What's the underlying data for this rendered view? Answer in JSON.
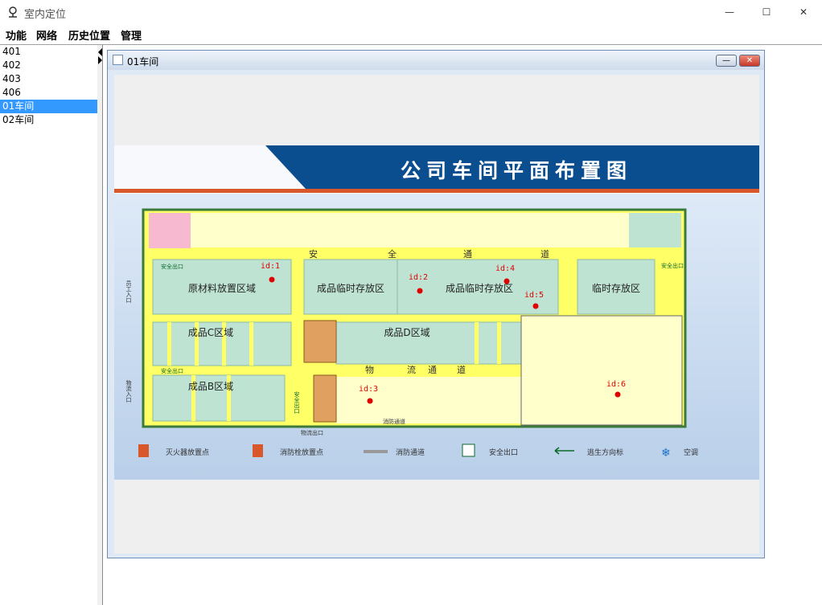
{
  "window": {
    "title": "室内定位",
    "controls": {
      "minimize": "—",
      "maximize": "☐",
      "close": "✕"
    }
  },
  "menu": {
    "items": [
      "功能",
      "网络",
      "历史位置",
      "管理"
    ]
  },
  "left_list": {
    "items": [
      "401",
      "402",
      "403",
      "406",
      "01车间",
      "02车间"
    ],
    "selected_index": 4
  },
  "internal_frame": {
    "title": "01车间",
    "min_label": "—",
    "close_label": "✕"
  },
  "floorplan": {
    "title": "公司车间平面布置图",
    "colors": {
      "banner": "#0b4e8f",
      "accent_bar": "#d9582b",
      "corridor": "#ffff00",
      "zone": "#bfe3d3",
      "area_cream": "#ffffcc",
      "marker": "#e00000"
    },
    "corridor_labels": {
      "safety_passage": [
        "安",
        "全",
        "通",
        "道"
      ],
      "logistics_passage": [
        "物",
        "流",
        "通",
        "道"
      ]
    },
    "zones": {
      "raw_material": "原材料放置区域",
      "temp_storage_1": "成品临时存放区",
      "temp_storage_2": "成品临时存放区",
      "temp_storage_3": "临时存放区",
      "product_c": "成品C区域",
      "product_d": "成品D区域",
      "product_b": "成品B区域"
    },
    "small_labels": {
      "exit_1": "安全出口",
      "exit_2": "安全出口",
      "exit_3": "安全出口",
      "staff_entrance": "员工入口",
      "logistics_entrance": "物流入口",
      "safety_exit_vertical": "安全出口",
      "logistics_exit": "物流出口",
      "fire_passage": "消防通道"
    },
    "markers": [
      "id:1",
      "id:2",
      "id:3",
      "id:4",
      "id:5",
      "id:6"
    ],
    "legend": [
      "灭火器放置点",
      "消防栓放置点",
      "消防通道",
      "安全出口",
      "逃生方向标",
      "空调"
    ]
  }
}
